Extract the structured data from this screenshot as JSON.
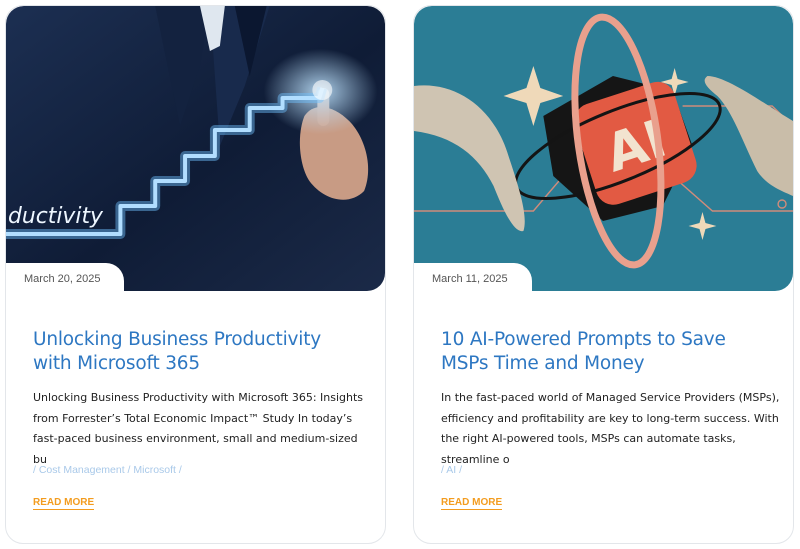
{
  "posts": [
    {
      "date": "March 20, 2025",
      "title": "Unlocking Business Productivity with Microsoft 365",
      "excerpt": "Unlocking Business Productivity with Microsoft 365: Insights from Forrester’s Total Economic Impact™ Study In today’s fast-paced business environment, small and medium-sized bu",
      "tags": "/ Cost Management / Microsoft /",
      "read_more": "READ MORE",
      "image_text": "ductivity"
    },
    {
      "date": "March 11, 2025",
      "title": "10 AI-Powered Prompts to Save MSPs Time and Money",
      "excerpt": "In the fast-paced world of Managed Service Providers (MSPs), efficiency and profitability are key to long-term success. With the right AI-powered tools, MSPs can automate tasks, streamline o",
      "tags": "/ AI /",
      "read_more": "READ MORE",
      "image_text": "AI"
    }
  ],
  "colors": {
    "title": "#2d77c2",
    "tags": "#a9c9e9",
    "read_more": "#f39c1f"
  }
}
